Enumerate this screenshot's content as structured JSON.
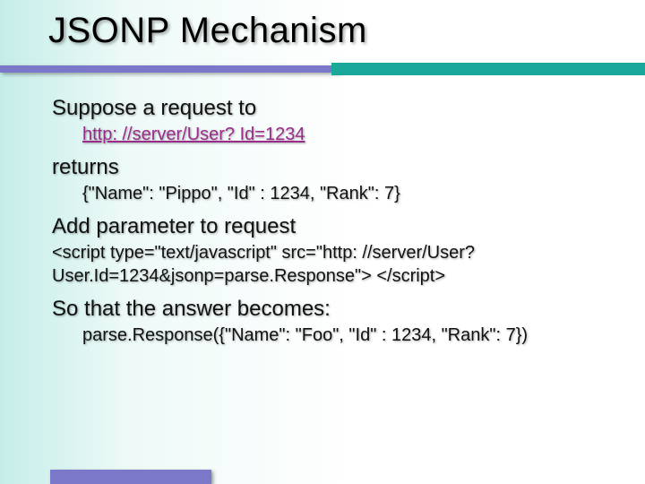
{
  "title": "JSONP Mechanism",
  "lines": {
    "l1": "Suppose a request to",
    "url": "http: //server/User? Id=1234",
    "l2": "returns",
    "json1": "{\"Name\": \"Pippo\", \"Id\" : 1234, \"Rank\": 7}",
    "l3": "Add parameter to request",
    "script_tag": "<script type=\"text/javascript\" src=\"http: //server/User? User.Id=1234&jsonp=parse.Response\"> </script>",
    "l4": "So that the answer becomes:",
    "json2": "parse.Response({\"Name\": \"Foo\", \"Id\" : 1234, \"Rank\": 7})"
  }
}
